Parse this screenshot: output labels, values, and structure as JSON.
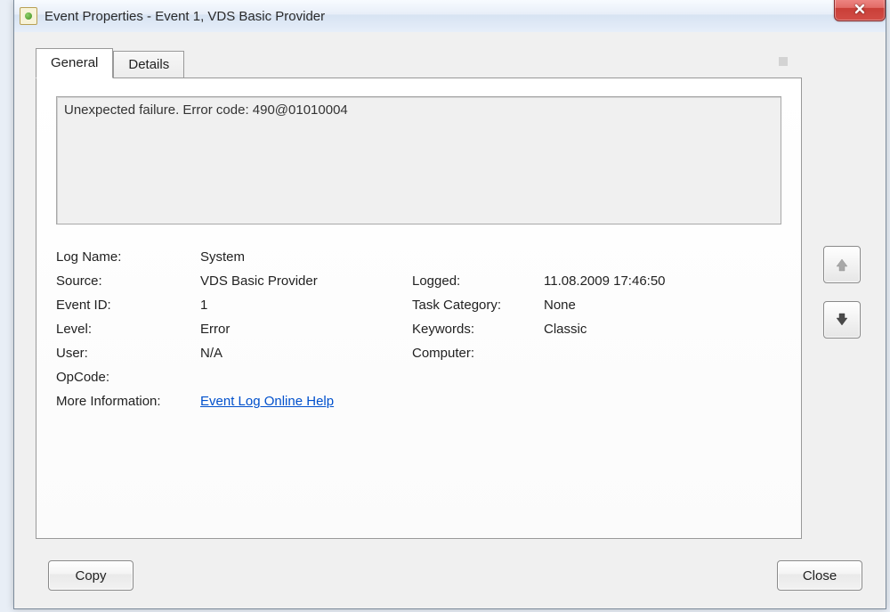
{
  "titlebar": {
    "title": "Event Properties - Event 1, VDS Basic Provider"
  },
  "tabs": {
    "general": "General",
    "details": "Details"
  },
  "description": "Unexpected failure. Error code: 490@01010004",
  "labels": {
    "log_name": "Log Name:",
    "source": "Source:",
    "logged": "Logged:",
    "event_id": "Event ID:",
    "task_category": "Task Category:",
    "level": "Level:",
    "keywords": "Keywords:",
    "user": "User:",
    "computer": "Computer:",
    "opcode": "OpCode:",
    "more_info": "More Information:"
  },
  "values": {
    "log_name": "System",
    "source": "VDS Basic Provider",
    "logged": "11.08.2009 17:46:50",
    "event_id": "1",
    "task_category": "None",
    "level": "Error",
    "keywords": "Classic",
    "user": "N/A",
    "computer": "",
    "opcode": "",
    "more_info_link": "Event Log Online Help"
  },
  "buttons": {
    "copy": "Copy",
    "close": "Close"
  }
}
